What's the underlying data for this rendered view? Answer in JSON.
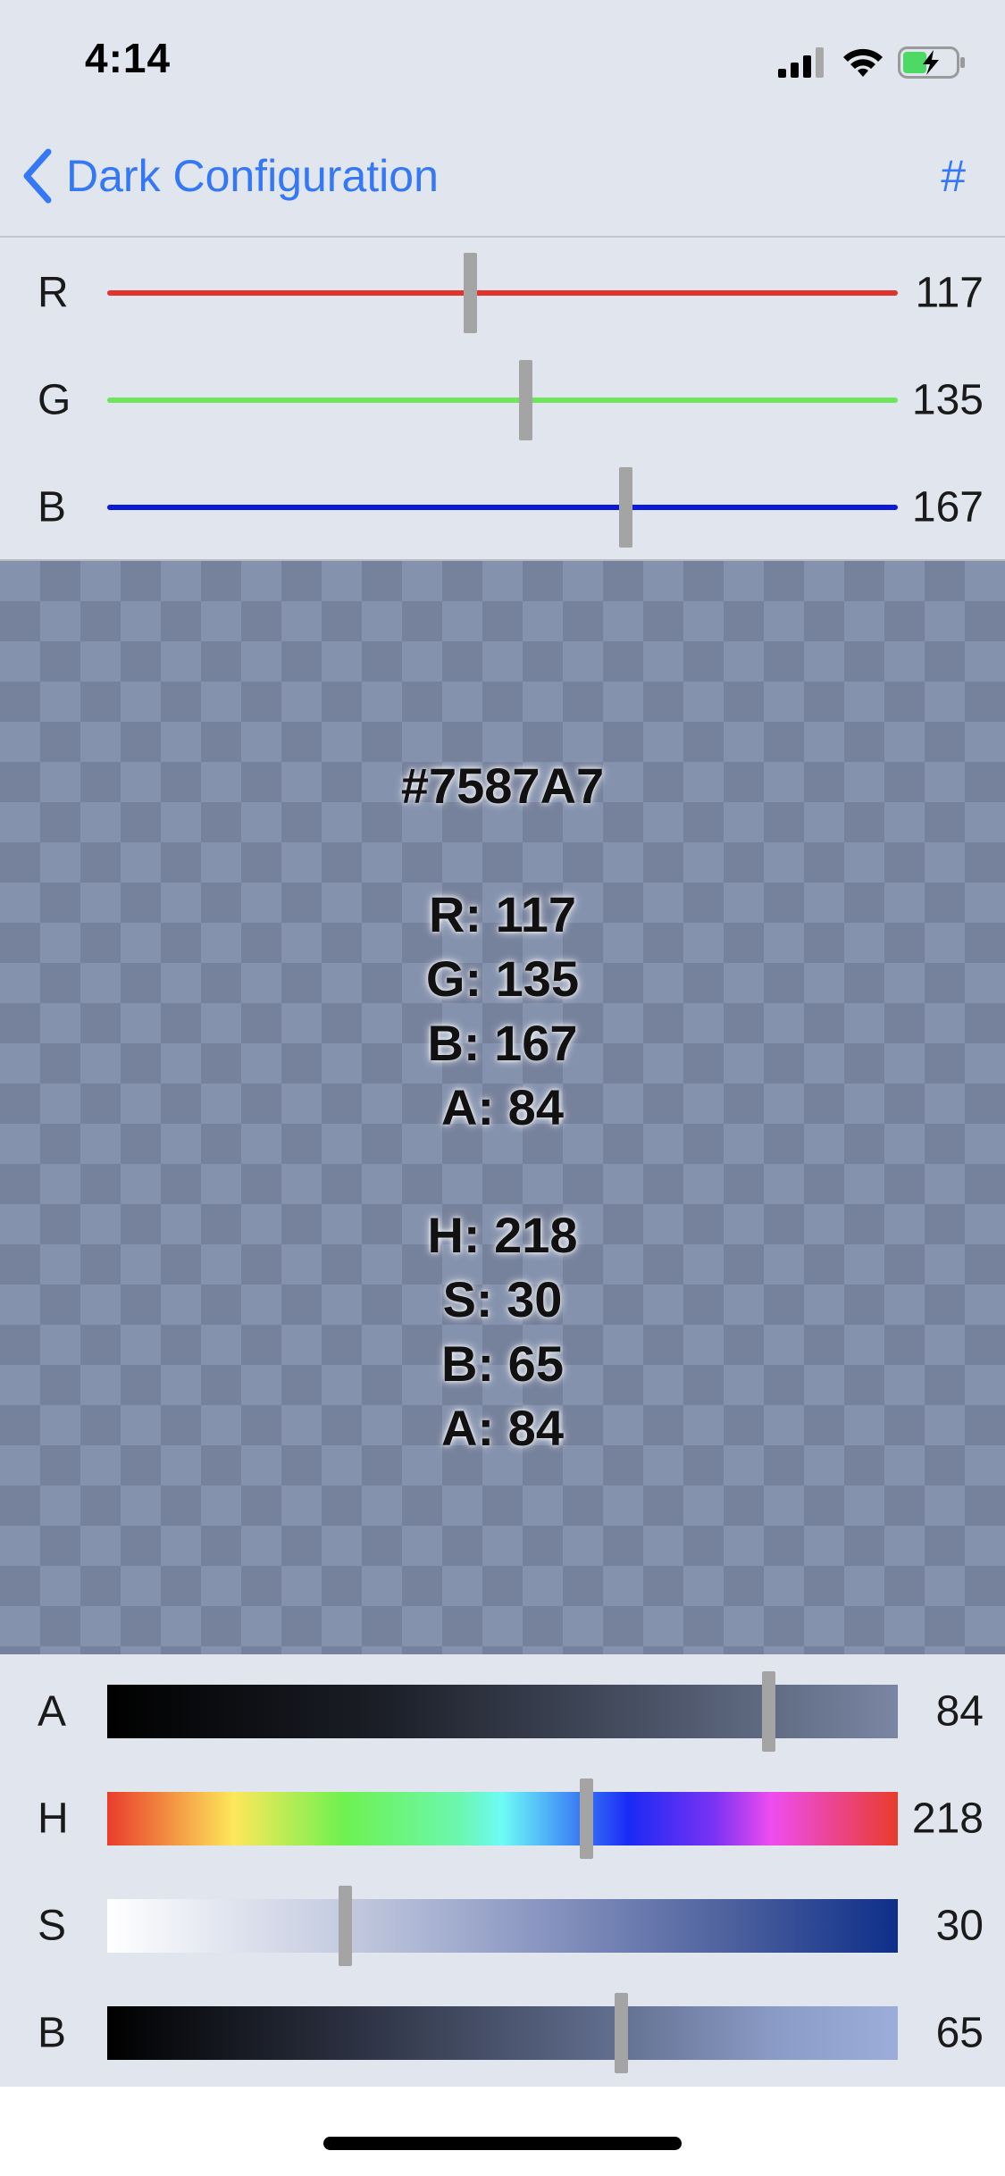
{
  "status_bar": {
    "time": "4:14",
    "icons": [
      "signal-icon",
      "wifi-icon",
      "battery-charging-icon"
    ]
  },
  "nav": {
    "back_label": "Dark Configuration",
    "hex_button": "#",
    "tint_color": "#3478f6"
  },
  "rgb_sliders": [
    {
      "letter": "R",
      "value": "117",
      "fraction": 0.459,
      "color": "#e2332b"
    },
    {
      "letter": "G",
      "value": "135",
      "fraction": 0.529,
      "color": "#6ee55b"
    },
    {
      "letter": "B",
      "value": "167",
      "fraction": 0.655,
      "color": "#0b1ad6"
    }
  ],
  "preview": {
    "hex": "#7587A7",
    "rgba": [
      "R: 117",
      "G: 135",
      "B: 167",
      "A: 84"
    ],
    "hsba": [
      "H: 218",
      "S: 30",
      "B: 65",
      "A: 84"
    ]
  },
  "hsb_sliders": [
    {
      "letter": "A",
      "value": "84",
      "fraction": 0.836,
      "gradient": "linear-gradient(to right, #000000 0%, #1c1f28 35%, #4b5468 70%, #7a86a3 100%)"
    },
    {
      "letter": "H",
      "value": "218",
      "fraction": 0.606,
      "gradient": "linear-gradient(to right, #e93c2b 0%, #fde85a 16%, #6ef150 30%, #6cf7b3 45%, #6dfbf6 50%, #1a2af5 66%, #7d33f3 77%, #ee4df0 84%, #e93c2b 100%)"
    },
    {
      "letter": "S",
      "value": "30",
      "fraction": 0.3,
      "gradient": "linear-gradient(to right, #ffffff 0%, #c4cbe0 30%, #8995c0 55%, #4a5e9c 80%, #0d2e8a 100%)"
    },
    {
      "letter": "B",
      "value": "65",
      "fraction": 0.65,
      "gradient": "linear-gradient(to right, #000000 0%, #2a2f3f 30%, #5a6684 60%, #8b9cc7 85%, #9cadd9 100%)"
    }
  ]
}
